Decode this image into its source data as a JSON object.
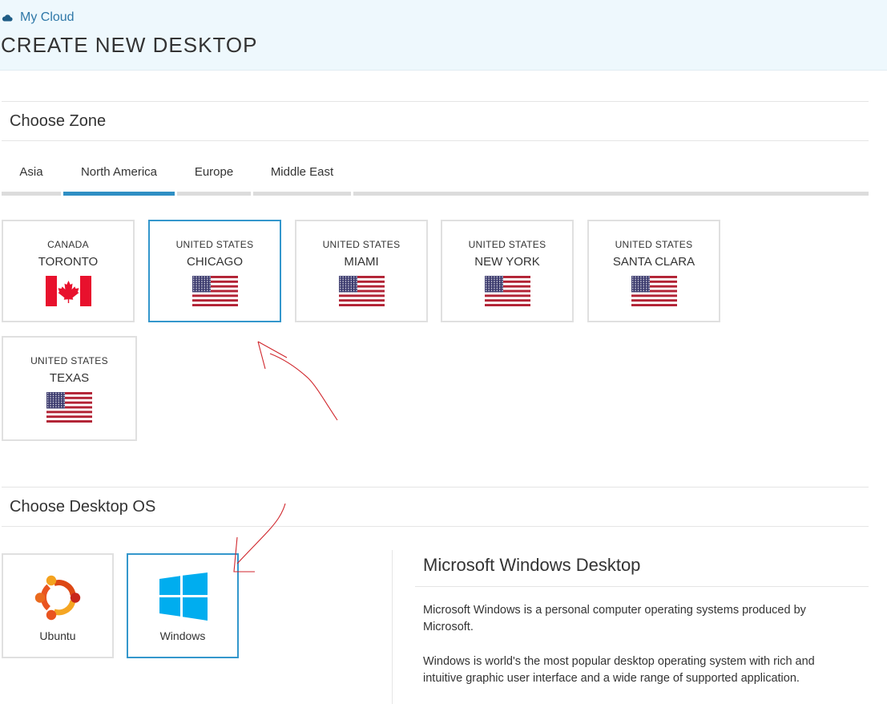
{
  "breadcrumb": {
    "label": "My Cloud",
    "icon": "cloud-icon"
  },
  "page_title": "CREATE NEW DESKTOP",
  "zone_section": {
    "title": "Choose Zone",
    "tabs": [
      {
        "label": "Asia",
        "active": false
      },
      {
        "label": "North America",
        "active": true
      },
      {
        "label": "Europe",
        "active": false
      },
      {
        "label": "Middle East",
        "active": false
      }
    ],
    "zones": [
      {
        "country": "CANADA",
        "city": "TORONTO",
        "flag": "canada-flag-icon",
        "selected": false
      },
      {
        "country": "UNITED STATES",
        "city": "CHICAGO",
        "flag": "us-flag-icon",
        "selected": true
      },
      {
        "country": "UNITED STATES",
        "city": "MIAMI",
        "flag": "us-flag-icon",
        "selected": false
      },
      {
        "country": "UNITED STATES",
        "city": "NEW YORK",
        "flag": "us-flag-icon",
        "selected": false
      },
      {
        "country": "UNITED STATES",
        "city": "SANTA CLARA",
        "flag": "us-flag-icon",
        "selected": false
      },
      {
        "country": "UNITED STATES",
        "city": "TEXAS",
        "flag": "us-flag-icon",
        "selected": false
      }
    ]
  },
  "os_section": {
    "title": "Choose Desktop OS",
    "options": [
      {
        "label": "Ubuntu",
        "icon": "ubuntu-logo-icon",
        "selected": false
      },
      {
        "label": "Windows",
        "icon": "windows-logo-icon",
        "selected": true
      }
    ],
    "detail": {
      "title": "Microsoft Windows Desktop",
      "paragraphs": [
        "Microsoft Windows is a personal computer operating systems produced by Microsoft.",
        "Windows is world's the most popular desktop operating system with rich and intuitive graphic user interface and a wide range of supported application."
      ]
    }
  },
  "colors": {
    "accent": "#3497cc",
    "tab_active": "#2f8fc4",
    "header_bg": "#eef8fd",
    "link": "#2f78a8",
    "annotation": "#d0262c"
  }
}
